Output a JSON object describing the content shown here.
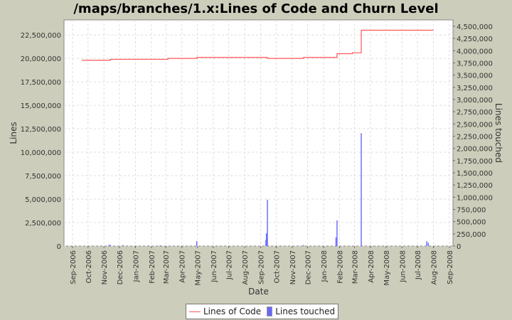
{
  "chart_data": {
    "type": "line+bar",
    "title": "/maps/branches/1.x:Lines of Code and Churn Level",
    "xlabel": "Date",
    "ylabel": "Lines",
    "y2label": "Lines touched",
    "xlim": [
      "2006-09-01",
      "2008-09-01"
    ],
    "ylim": [
      0,
      24100000
    ],
    "y2lim": [
      0,
      4630000
    ],
    "grid": true,
    "legend": "bottom",
    "x_tick_labels": [
      "Sep-2006",
      "Oct-2006",
      "Nov-2006",
      "Dec-2006",
      "Jan-2007",
      "Feb-2007",
      "Mar-2007",
      "Apr-2007",
      "May-2007",
      "Jun-2007",
      "Jul-2007",
      "Aug-2007",
      "Sep-2007",
      "Oct-2007",
      "Nov-2007",
      "Dec-2007",
      "Jan-2008",
      "Feb-2008",
      "Mar-2008",
      "Apr-2008",
      "May-2008",
      "Jun-2008",
      "Jul-2008",
      "Aug-2008",
      "Sep-2008"
    ],
    "y_tick_labels": [
      "0",
      "2,500,000",
      "5,000,000",
      "7,500,000",
      "10,000,000",
      "12,500,000",
      "15,000,000",
      "17,500,000",
      "20,000,000",
      "22,500,000"
    ],
    "y2_tick_labels": [
      "0",
      "250,000",
      "500,000",
      "750,000",
      "1,000,000",
      "1,250,000",
      "1,500,000",
      "1,750,000",
      "2,000,000",
      "2,250,000",
      "2,500,000",
      "2,750,000",
      "3,000,000",
      "3,250,000",
      "3,500,000",
      "3,750,000",
      "4,000,000",
      "4,250,000",
      "4,500,000"
    ],
    "series": [
      {
        "name": "Lines of Code",
        "type": "step-line",
        "axis": "left",
        "color": "#ff5555",
        "points": [
          [
            "2006-09-19",
            19800000
          ],
          [
            "2006-11-13",
            19900000
          ],
          [
            "2007-03-05",
            20000000
          ],
          [
            "2007-04-30",
            20100000
          ],
          [
            "2007-09-14",
            20000000
          ],
          [
            "2007-11-23",
            20100000
          ],
          [
            "2008-01-27",
            20500000
          ],
          [
            "2008-02-26",
            20600000
          ],
          [
            "2008-03-14",
            23000000
          ],
          [
            "2008-08-01",
            23000000
          ]
        ]
      },
      {
        "name": "Lines touched",
        "type": "bar",
        "axis": "right",
        "color": "#6666ff",
        "points": [
          [
            "2006-11-10",
            20000
          ],
          [
            "2006-11-13",
            25000
          ],
          [
            "2006-12-08",
            20000
          ],
          [
            "2007-01-27",
            10000
          ],
          [
            "2007-02-18",
            15000
          ],
          [
            "2007-04-30",
            100000
          ],
          [
            "2007-09-11",
            120000
          ],
          [
            "2007-09-12",
            260000
          ],
          [
            "2007-09-14",
            950000
          ],
          [
            "2007-11-23",
            20000
          ],
          [
            "2008-01-25",
            175000
          ],
          [
            "2008-01-27",
            525000
          ],
          [
            "2008-03-14",
            2310000
          ],
          [
            "2008-07-19",
            100000
          ],
          [
            "2008-07-22",
            70000
          ]
        ]
      }
    ]
  }
}
